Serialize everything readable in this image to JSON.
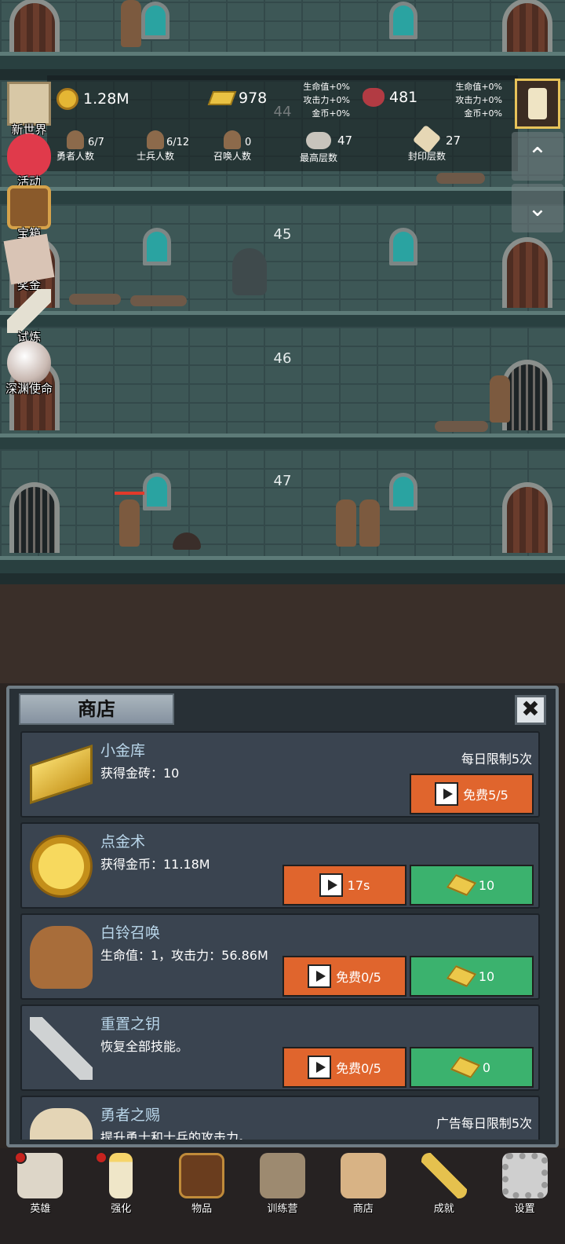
{
  "hud": {
    "gold": "1.28M",
    "gold_bars": "978",
    "gems": "481",
    "bonus_left": [
      "生命值+0%",
      "攻击力+0%",
      "金币+0%"
    ],
    "bonus_right": [
      "生命值+0%",
      "攻击力+0%",
      "金币+0%"
    ],
    "heroes": {
      "value": "6/7",
      "label": "勇者人数"
    },
    "soldiers": {
      "value": "6/12",
      "label": "士兵人数"
    },
    "summons": {
      "value": "0",
      "label": "召唤人数"
    },
    "max_floor": {
      "value": "47",
      "label": "最高层数"
    },
    "sealed_floor": {
      "value": "27",
      "label": "封印层数"
    }
  },
  "floors": [
    "44",
    "45",
    "46",
    "47"
  ],
  "side_menu": [
    {
      "label": "新世界",
      "icon": "map-icon"
    },
    {
      "label": "活动",
      "icon": "heart-icon"
    },
    {
      "label": "宝箱",
      "icon": "chest-icon"
    },
    {
      "label": "奖金",
      "icon": "letter-icon"
    },
    {
      "label": "试炼",
      "icon": "feather-icon"
    },
    {
      "label": "深渊使命",
      "icon": "orb-icon"
    }
  ],
  "right_controls": {
    "up": "⌃",
    "down": "⌄"
  },
  "shop": {
    "title": "商店",
    "close": "✖",
    "items": [
      {
        "name": "小金库",
        "desc": "获得金砖：10",
        "limit": "每日限制5次",
        "ad_label": "免费5/5",
        "price": ""
      },
      {
        "name": "点金术",
        "desc": "获得金币：11.18M",
        "limit": "",
        "ad_label": "17s",
        "price": "10"
      },
      {
        "name": "白铃召唤",
        "desc": "生命值：1，攻击力：56.86M",
        "limit": "",
        "ad_label": "免费0/5",
        "price": "10"
      },
      {
        "name": "重置之钥",
        "desc": "恢复全部技能。",
        "limit": "",
        "ad_label": "免费0/5",
        "price": "0"
      },
      {
        "name": "勇者之赐",
        "desc": "提升勇士和士兵的攻击力。",
        "limit": "广告每日限制5次",
        "ad_label": "",
        "price": ""
      }
    ]
  },
  "nav": [
    {
      "label": "英雄",
      "icon": "skull-icon"
    },
    {
      "label": "强化",
      "icon": "candle-icon"
    },
    {
      "label": "物品",
      "icon": "book-icon"
    },
    {
      "label": "训练营",
      "icon": "lantern-icon"
    },
    {
      "label": "商店",
      "icon": "mug-icon"
    },
    {
      "label": "成就",
      "icon": "key-icon"
    },
    {
      "label": "设置",
      "icon": "gear-icon"
    }
  ]
}
